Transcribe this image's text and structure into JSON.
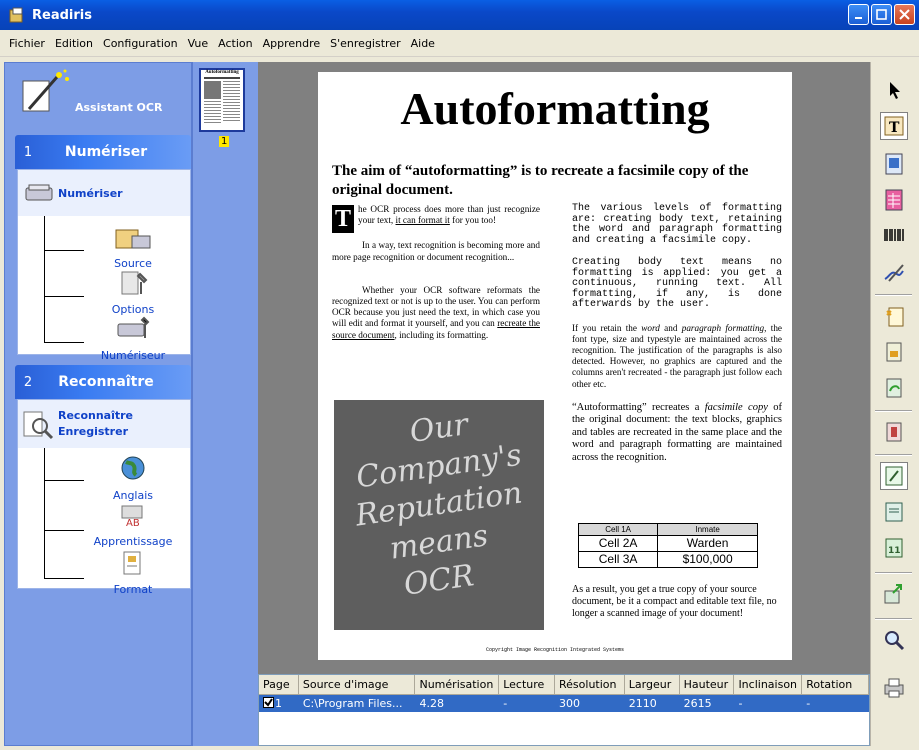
{
  "window": {
    "title": "Readiris"
  },
  "menu": [
    "Fichier",
    "Edition",
    "Configuration",
    "Vue",
    "Action",
    "Apprendre",
    "S'enregistrer",
    "Aide"
  ],
  "sidebar": {
    "assistant_label": "Assistant OCR",
    "section1": {
      "number": "1",
      "title": "Numériser",
      "top_label": "Numériser",
      "items": [
        "Source",
        "Options",
        "Numériseur"
      ]
    },
    "section2": {
      "number": "2",
      "title": "Reconnaître",
      "top_label_line1": "Reconnaître",
      "top_label_line2": "Enregistrer",
      "items": [
        "Anglais",
        "Apprentissage",
        "Format"
      ]
    }
  },
  "thumbnails": {
    "thumb_title": "Autoformatting",
    "page_number": "1"
  },
  "document": {
    "title": "Autoformatting",
    "subtitle": "The aim of “autoformatting” is to recreate a facsimile copy of the original document.",
    "drop_cap": "T",
    "col1_p1_a": "he OCR process does more than just recognize your text, ",
    "col1_p1_link": "it can format it",
    "col1_p1_b": " for you too!",
    "col1_p2": "In a way, text recognition is becoming more and more page recognition or document recognition...",
    "col1_p3_a": "Whether your OCR software reformats the recognized text or not is up to the user. You can perform OCR because you just need the text, in which case you will edit and format it yourself, and you can ",
    "col1_p3_link": "recreate the source document",
    "col1_p3_b": ", including its formatting.",
    "photo_lines": [
      "Our",
      "Company's",
      "Reputation",
      "means",
      "OCR"
    ],
    "col2_p1": "The various levels of formatting are: creating body text, retaining the word and paragraph formatting and creating a facsimile copy.",
    "col2_p2": "Creating body text means no formatting is applied: you get a continuous, running text. All formatting, if any, is done afterwards by the user.",
    "col2_p3_a": "If you retain the ",
    "col2_p3_i1": "word",
    "col2_p3_b": " and ",
    "col2_p3_i2": "paragraph formatting",
    "col2_p3_c": ", the font type, size and typestyle are maintained across the recognition. The justification of the paragraphs is also detected. However, no graphics are captured and the columns aren't recreated - the paragraph just follow each other etc.",
    "col2_p4_a": "“Autoformatting” recreates a ",
    "col2_p4_i": "facsimile copy",
    "col2_p4_b": " of the original document: the text blocks, graphics and tables are recreated in the same place and the word and paragraph formatting are maintained across the recognition.",
    "table": [
      [
        "Cell 1A",
        "Inmate"
      ],
      [
        "Cell 2A",
        "Warden"
      ],
      [
        "Cell 3A",
        "$100,000"
      ]
    ],
    "col2_p5": "As a result, you get a true copy of your source document, be it a compact and editable text file, no longer a scanned image of your document!",
    "copyright": "Copyright Image Recognition Integrated Systems"
  },
  "list": {
    "headers": [
      "Page",
      "Source d'image",
      "Numérisation",
      "Lecture",
      "Résolution",
      "Largeur",
      "Hauteur",
      "Inclinaison",
      "Rotation"
    ],
    "row": {
      "page": "1",
      "source": "C:\\Program Files...",
      "numerisation": "4.28",
      "lecture": "-",
      "resolution": "300",
      "largeur": "2110",
      "hauteur": "2615",
      "inclinaison": "-",
      "rotation": "-"
    }
  },
  "colors": {
    "titlebar": "#0a5fe4",
    "sidebar": "#7d9de6",
    "section_header": "#2a5fd6",
    "selection": "#316ac5"
  }
}
